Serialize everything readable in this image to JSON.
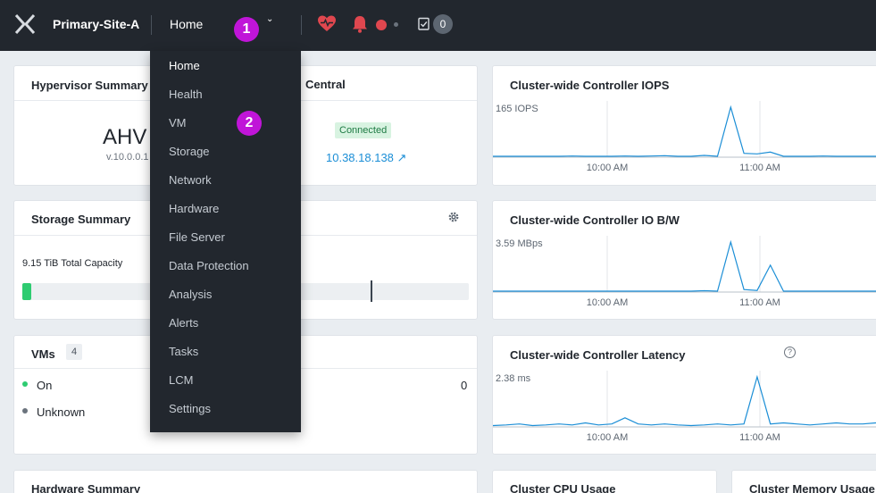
{
  "topbar": {
    "cluster_name": "Primary-Site-A",
    "nav_current": "Home",
    "task_count": "0"
  },
  "steps": {
    "one": "1",
    "two": "2"
  },
  "menu": {
    "items": [
      "Home",
      "Health",
      "VM",
      "Storage",
      "Network",
      "Hardware",
      "File Server",
      "Data Protection",
      "Analysis",
      "Alerts",
      "Tasks",
      "LCM",
      "Settings"
    ],
    "active": "Home"
  },
  "hypervisor_summary": {
    "title": "Hypervisor Summary",
    "hypervisor": "AHV",
    "version": "v.10.0.0.1",
    "central_title": "Central",
    "status": "Connected",
    "pc_ip": "10.38.18.138 ↗"
  },
  "storage_summary": {
    "title": "Storage Summary",
    "capacity_label": "9.15 TiB  Total Capacity",
    "used_fraction": 0.02,
    "threshold_fraction": 0.78
  },
  "vms": {
    "title": "VMs",
    "count": "4",
    "legend": [
      {
        "label": "On",
        "color": "#2ecc71"
      },
      {
        "label": "Unknown",
        "color": "#6b737d"
      }
    ],
    "second_column_value": "0"
  },
  "hardware_summary": {
    "title": "Hardware Summary"
  },
  "cluster_cpu": {
    "title": "Cluster CPU Usage"
  },
  "cluster_memory": {
    "title": "Cluster Memory Usage"
  },
  "colors": {
    "accent": "#1b8ed6",
    "topbar": "#22272e",
    "step_marker": "#c015d8",
    "success": "#2ecc71"
  },
  "chart_data": [
    {
      "type": "line",
      "title": "Cluster-wide Controller IOPS",
      "peak_label": "165 IOPS",
      "x_ticks": [
        "10:00 AM",
        "11:00 AM"
      ],
      "ylim": [
        0,
        165
      ],
      "series": [
        {
          "values": [
            0,
            0,
            0,
            0,
            0,
            0,
            1,
            0,
            0,
            0,
            1,
            0,
            1,
            2,
            0,
            0,
            3,
            0,
            165,
            10,
            8,
            14,
            0,
            0,
            0,
            1,
            0,
            0,
            0,
            0
          ]
        }
      ]
    },
    {
      "type": "line",
      "title": "Cluster-wide Controller IO B/W",
      "peak_label": "3.59 MBps",
      "x_ticks": [
        "10:00 AM",
        "11:00 AM"
      ],
      "ylim": [
        0,
        3.59
      ],
      "series": [
        {
          "values": [
            0,
            0,
            0,
            0,
            0,
            0,
            0,
            0,
            0,
            0,
            0,
            0,
            0,
            0,
            0,
            0,
            0.03,
            0,
            3.59,
            0.12,
            0.05,
            1.9,
            0,
            0,
            0,
            0,
            0,
            0,
            0,
            0
          ]
        }
      ]
    },
    {
      "type": "line",
      "title": "Cluster-wide Controller Latency",
      "peak_label": "2.38 ms",
      "x_ticks": [
        "10:00 AM",
        "11:00 AM"
      ],
      "ylim": [
        0,
        2.38
      ],
      "series": [
        {
          "values": [
            0.02,
            0.05,
            0.1,
            0.02,
            0.05,
            0.1,
            0.05,
            0.15,
            0.05,
            0.1,
            0.4,
            0.1,
            0.05,
            0.1,
            0.05,
            0.02,
            0.05,
            0.1,
            0.05,
            0.1,
            2.38,
            0.1,
            0.15,
            0.1,
            0.05,
            0.1,
            0.15,
            0.1,
            0.1,
            0.15
          ]
        }
      ]
    }
  ]
}
